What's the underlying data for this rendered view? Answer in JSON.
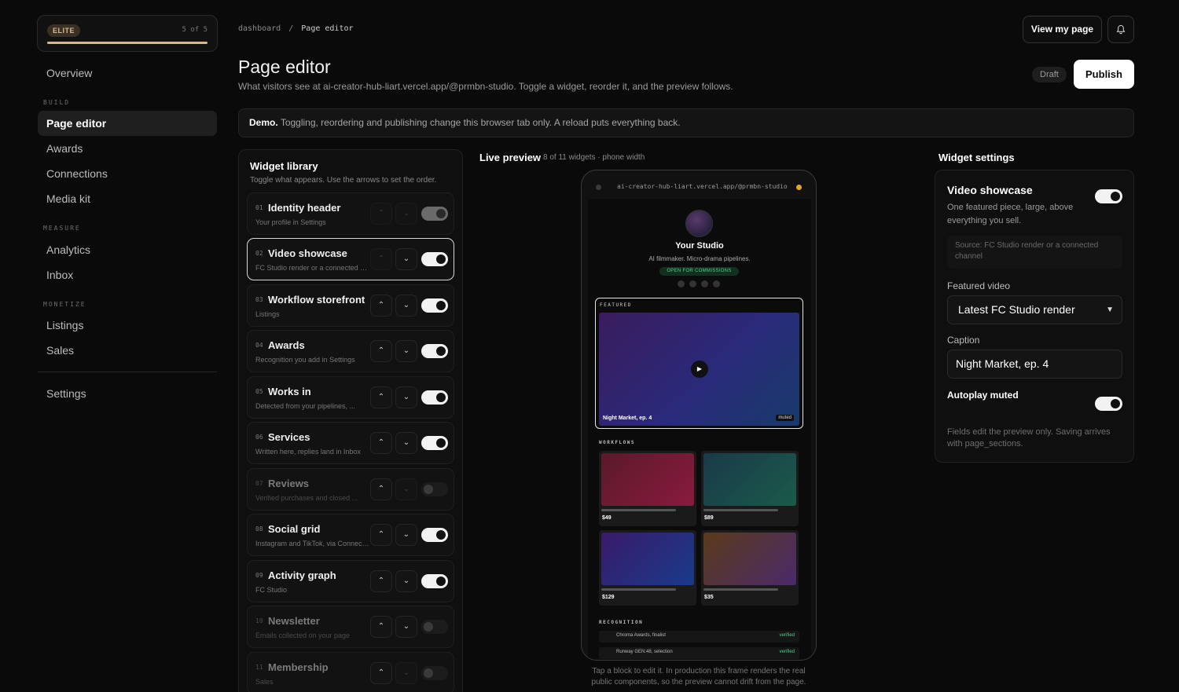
{
  "sidebar": {
    "tier": {
      "badge": "ELITE",
      "count": "5 of 5",
      "progress": 1.0
    },
    "items": [
      {
        "label": "Overview"
      },
      {
        "label": "Page editor"
      },
      {
        "label": "Awards"
      },
      {
        "label": "Connections"
      },
      {
        "label": "Media kit"
      },
      {
        "label": "Analytics"
      },
      {
        "label": "Inbox"
      },
      {
        "label": "Listings"
      },
      {
        "label": "Sales"
      },
      {
        "label": "Settings"
      }
    ],
    "sections": {
      "build": "BUILD",
      "measure": "MEASURE",
      "monetize": "MONETIZE"
    }
  },
  "header": {
    "breadcrumb_root": "dashboard",
    "breadcrumb_sep": "/",
    "breadcrumb_current": "Page editor",
    "view_button": "View my page",
    "title": "Page editor",
    "subtitle": "What visitors see at ai-creator-hub-liart.vercel.app/@prmbn-studio. Toggle a widget, reorder it, and the preview follows.",
    "status": "Draft",
    "publish": "Publish"
  },
  "demo": {
    "lead": "Demo.",
    "text": "Toggling, reordering and publishing change this browser tab only. A reload puts everything back."
  },
  "library": {
    "title": "Widget library",
    "subtitle": "Toggle what appears. Use the arrows to set the order.",
    "widgets": [
      {
        "num": "01",
        "name": "Identity header",
        "desc": "Your profile in Settings",
        "on": true
      },
      {
        "num": "02",
        "name": "Video showcase",
        "desc": "FC Studio render or a connected channel",
        "on": true
      },
      {
        "num": "03",
        "name": "Workflow storefront",
        "desc": "Listings",
        "on": true
      },
      {
        "num": "04",
        "name": "Awards",
        "desc": "Recognition you add in Settings",
        "on": true
      },
      {
        "num": "05",
        "name": "Works in",
        "desc": "Detected from your pipelines, ...",
        "on": true
      },
      {
        "num": "06",
        "name": "Services",
        "desc": "Written here, replies land in Inbox",
        "on": true
      },
      {
        "num": "07",
        "name": "Reviews",
        "desc": "Verified purchases and closed ...",
        "on": false
      },
      {
        "num": "08",
        "name": "Social grid",
        "desc": "Instagram and TikTok, via Connections",
        "on": true
      },
      {
        "num": "09",
        "name": "Activity graph",
        "desc": "FC Studio",
        "on": true
      },
      {
        "num": "10",
        "name": "Newsletter",
        "desc": "Emails collected on your page",
        "on": false
      },
      {
        "num": "11",
        "name": "Membership",
        "desc": "Sales",
        "on": false
      }
    ]
  },
  "preview": {
    "title": "Live preview",
    "meta": "8 of 11 widgets · phone width",
    "url": "ai-creator-hub-liart.vercel.app/@prmbn-studio",
    "studio_name": "Your Studio",
    "studio_bio": "AI filmmaker. Micro-drama pipelines.",
    "open_badge": "OPEN FOR COMMISSIONS",
    "featured_label": "FEATURED",
    "featured_caption": "Night Market, ep. 4",
    "featured_tag": "muted",
    "workflows_label": "WORKFLOWS",
    "workflows": [
      {
        "price": "$49",
        "color_a": "#5a1a2a",
        "color_b": "#8a1a3e"
      },
      {
        "price": "$89",
        "color_a": "#1a3a4a",
        "color_b": "#1a5a4a"
      },
      {
        "price": "$129",
        "color_a": "#3a1a6a",
        "color_b": "#1a3a8a"
      },
      {
        "price": "$35",
        "color_a": "#5a3a1a",
        "color_b": "#4a2a6a"
      }
    ],
    "recognition_label": "RECOGNITION",
    "recognition": [
      {
        "name": "Chroma Awards, finalist",
        "status": "verified"
      },
      {
        "name": "Runway GEN:48, selection",
        "status": "verified"
      }
    ],
    "note": "Tap a block to edit it. In production this frame renders the real public components, so the preview cannot drift from the page."
  },
  "settings": {
    "title": "Widget settings",
    "widget_name": "Video showcase",
    "widget_desc": "One featured piece, large, above everything you sell.",
    "source_text": "Source: FC Studio render or a connected channel",
    "featured_label": "Featured video",
    "featured_value": "Latest FC Studio render",
    "caption_label": "Caption",
    "caption_value": "Night Market, ep. 4",
    "autoplay_label": "Autoplay muted",
    "footer": "Fields edit the preview only. Saving arrives with page_sections."
  }
}
